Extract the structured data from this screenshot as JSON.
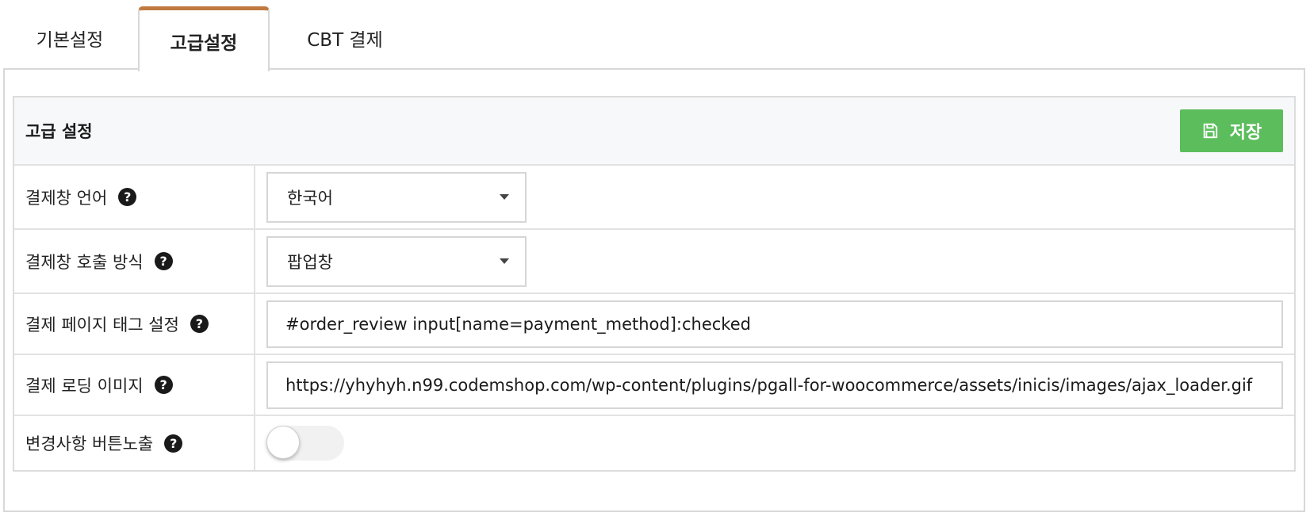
{
  "tabs": [
    {
      "label": "기본설정"
    },
    {
      "label": "고급설정",
      "active": true
    },
    {
      "label": "CBT 결제"
    }
  ],
  "section": {
    "title": "고급 설정",
    "save_label": "저장",
    "save_color": "#5cbd5c"
  },
  "rows": [
    {
      "label": "결제창 언어",
      "type": "select",
      "value": "한국어"
    },
    {
      "label": "결제창 호출 방식",
      "type": "select",
      "value": "팝업창"
    },
    {
      "label": "결제 페이지 태그 설정",
      "type": "text",
      "value": "#order_review input[name=payment_method]:checked"
    },
    {
      "label": "결제 로딩 이미지",
      "type": "text",
      "value": "https://yhyhyh.n99.codemshop.com/wp-content/plugins/pgall-for-woocommerce/assets/inicis/images/ajax_loader.gif"
    },
    {
      "label": "변경사항 버튼노출",
      "type": "toggle",
      "checked": false
    }
  ],
  "icons": {
    "help": "question-circle-icon",
    "save": "floppy-disk-icon",
    "dropdown": "caret-down-icon"
  },
  "help_glyph": "?",
  "active_tab_color": "#c07a3f"
}
